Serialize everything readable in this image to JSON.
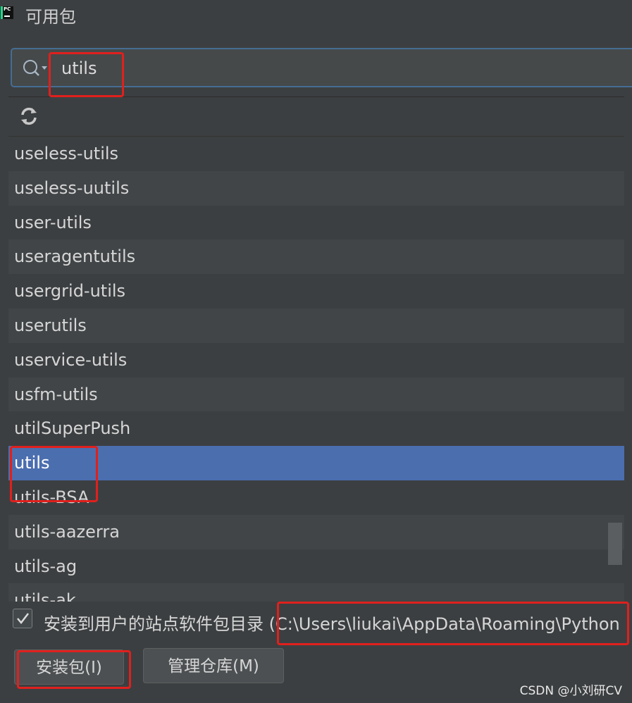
{
  "window": {
    "title": "可用包"
  },
  "search": {
    "value": "utils"
  },
  "packages": [
    "useless-utils",
    "useless-uutils",
    "user-utils",
    "useragentutils",
    "usergrid-utils",
    "userutils",
    "uservice-utils",
    "usfm-utils",
    "utilSuperPush",
    "utils",
    "utils-BSA",
    "utils-aazerra",
    "utils-ag",
    "utils-ak"
  ],
  "selected_package": "utils",
  "install_option": {
    "checked": true,
    "label": "安装到用户的站点软件包目录 (C:\\Users\\liukai\\AppData\\Roaming\\Python"
  },
  "buttons": {
    "install": "安装包(I)",
    "manage": "管理仓库(M)"
  },
  "watermark": "CSDN @小刘研CV",
  "colors": {
    "background": "#3c3f41",
    "selection": "#4b6eaf",
    "focus_border": "#466d94",
    "annotation_red": "#e0201d"
  }
}
